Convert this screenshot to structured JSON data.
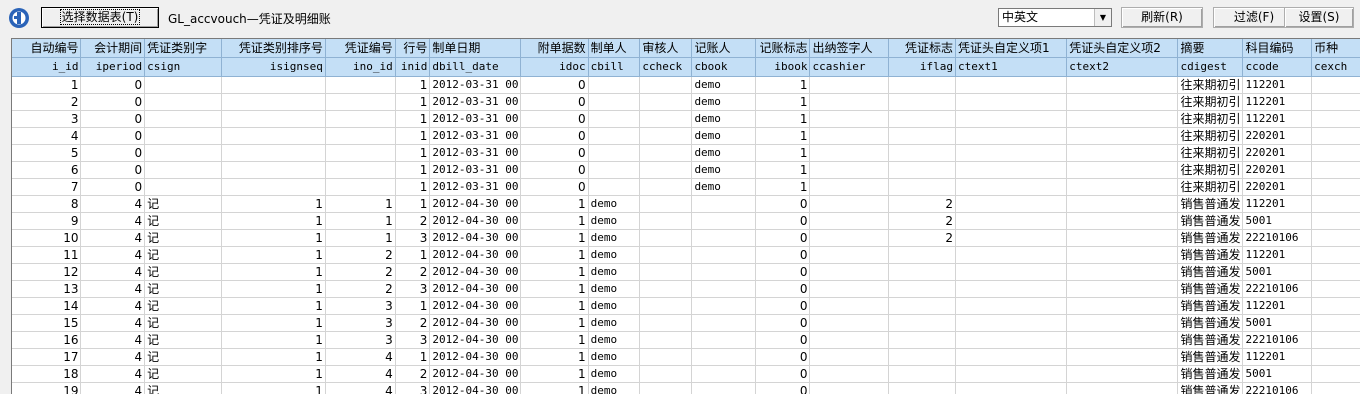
{
  "toolbar": {
    "select_table_label": "选择数据表(T)",
    "title": "GL_accvouch—凭证及明细账",
    "language_value": "中英文",
    "refresh_label": "刷新(R)",
    "filter_label": "过滤(F)",
    "settings_label": "设置(S)"
  },
  "grid": {
    "columns": [
      {
        "cn": "自动编号",
        "en": "i_id",
        "align": "r"
      },
      {
        "cn": "会计期间",
        "en": "iperiod",
        "align": "r"
      },
      {
        "cn": "凭证类别字",
        "en": "csign",
        "align": "l"
      },
      {
        "cn": "凭证类别排序号",
        "en": "isignseq",
        "align": "r"
      },
      {
        "cn": "凭证编号",
        "en": "ino_id",
        "align": "r"
      },
      {
        "cn": "行号",
        "en": "inid",
        "align": "r"
      },
      {
        "cn": "制单日期",
        "en": "dbill_date",
        "align": "l"
      },
      {
        "cn": "附单据数",
        "en": "idoc",
        "align": "r"
      },
      {
        "cn": "制单人",
        "en": "cbill",
        "align": "l"
      },
      {
        "cn": "审核人",
        "en": "ccheck",
        "align": "l"
      },
      {
        "cn": "记账人",
        "en": "cbook",
        "align": "l"
      },
      {
        "cn": "记账标志",
        "en": "ibook",
        "align": "r"
      },
      {
        "cn": "出纳签字人",
        "en": "ccashier",
        "align": "l"
      },
      {
        "cn": "凭证标志",
        "en": "iflag",
        "align": "r"
      },
      {
        "cn": "凭证头自定义项1",
        "en": "ctext1",
        "align": "l"
      },
      {
        "cn": "凭证头自定义项2",
        "en": "ctext2",
        "align": "l"
      },
      {
        "cn": "摘要",
        "en": "cdigest",
        "align": "l"
      },
      {
        "cn": "科目编码",
        "en": "ccode",
        "align": "l"
      },
      {
        "cn": "币种",
        "en": "cexch",
        "align": "l"
      }
    ],
    "rows": [
      [
        "1",
        "0",
        "",
        "",
        "",
        "1",
        "2012-03-31 00",
        "0",
        "",
        "",
        "demo",
        "1",
        "",
        "",
        "",
        "",
        "往来期初引",
        "112201",
        ""
      ],
      [
        "2",
        "0",
        "",
        "",
        "",
        "1",
        "2012-03-31 00",
        "0",
        "",
        "",
        "demo",
        "1",
        "",
        "",
        "",
        "",
        "往来期初引",
        "112201",
        ""
      ],
      [
        "3",
        "0",
        "",
        "",
        "",
        "1",
        "2012-03-31 00",
        "0",
        "",
        "",
        "demo",
        "1",
        "",
        "",
        "",
        "",
        "往来期初引",
        "112201",
        ""
      ],
      [
        "4",
        "0",
        "",
        "",
        "",
        "1",
        "2012-03-31 00",
        "0",
        "",
        "",
        "demo",
        "1",
        "",
        "",
        "",
        "",
        "往来期初引",
        "220201",
        ""
      ],
      [
        "5",
        "0",
        "",
        "",
        "",
        "1",
        "2012-03-31 00",
        "0",
        "",
        "",
        "demo",
        "1",
        "",
        "",
        "",
        "",
        "往来期初引",
        "220201",
        ""
      ],
      [
        "6",
        "0",
        "",
        "",
        "",
        "1",
        "2012-03-31 00",
        "0",
        "",
        "",
        "demo",
        "1",
        "",
        "",
        "",
        "",
        "往来期初引",
        "220201",
        ""
      ],
      [
        "7",
        "0",
        "",
        "",
        "",
        "1",
        "2012-03-31 00",
        "0",
        "",
        "",
        "demo",
        "1",
        "",
        "",
        "",
        "",
        "往来期初引",
        "220201",
        ""
      ],
      [
        "8",
        "4",
        "记",
        "1",
        "1",
        "1",
        "2012-04-30 00",
        "1",
        "demo",
        "",
        "",
        "0",
        "",
        "2",
        "",
        "",
        "销售普通发",
        "112201",
        ""
      ],
      [
        "9",
        "4",
        "记",
        "1",
        "1",
        "2",
        "2012-04-30 00",
        "1",
        "demo",
        "",
        "",
        "0",
        "",
        "2",
        "",
        "",
        "销售普通发",
        "5001",
        ""
      ],
      [
        "10",
        "4",
        "记",
        "1",
        "1",
        "3",
        "2012-04-30 00",
        "1",
        "demo",
        "",
        "",
        "0",
        "",
        "2",
        "",
        "",
        "销售普通发",
        "22210106",
        ""
      ],
      [
        "11",
        "4",
        "记",
        "1",
        "2",
        "1",
        "2012-04-30 00",
        "1",
        "demo",
        "",
        "",
        "0",
        "",
        "",
        "",
        "",
        "销售普通发",
        "112201",
        ""
      ],
      [
        "12",
        "4",
        "记",
        "1",
        "2",
        "2",
        "2012-04-30 00",
        "1",
        "demo",
        "",
        "",
        "0",
        "",
        "",
        "",
        "",
        "销售普通发",
        "5001",
        ""
      ],
      [
        "13",
        "4",
        "记",
        "1",
        "2",
        "3",
        "2012-04-30 00",
        "1",
        "demo",
        "",
        "",
        "0",
        "",
        "",
        "",
        "",
        "销售普通发",
        "22210106",
        ""
      ],
      [
        "14",
        "4",
        "记",
        "1",
        "3",
        "1",
        "2012-04-30 00",
        "1",
        "demo",
        "",
        "",
        "0",
        "",
        "",
        "",
        "",
        "销售普通发",
        "112201",
        ""
      ],
      [
        "15",
        "4",
        "记",
        "1",
        "3",
        "2",
        "2012-04-30 00",
        "1",
        "demo",
        "",
        "",
        "0",
        "",
        "",
        "",
        "",
        "销售普通发",
        "5001",
        ""
      ],
      [
        "16",
        "4",
        "记",
        "1",
        "3",
        "3",
        "2012-04-30 00",
        "1",
        "demo",
        "",
        "",
        "0",
        "",
        "",
        "",
        "",
        "销售普通发",
        "22210106",
        ""
      ],
      [
        "17",
        "4",
        "记",
        "1",
        "4",
        "1",
        "2012-04-30 00",
        "1",
        "demo",
        "",
        "",
        "0",
        "",
        "",
        "",
        "",
        "销售普通发",
        "112201",
        ""
      ],
      [
        "18",
        "4",
        "记",
        "1",
        "4",
        "2",
        "2012-04-30 00",
        "1",
        "demo",
        "",
        "",
        "0",
        "",
        "",
        "",
        "",
        "销售普通发",
        "5001",
        ""
      ],
      [
        "19",
        "4",
        "记",
        "1",
        "4",
        "3",
        "2012-04-30 00",
        "1",
        "demo",
        "",
        "",
        "0",
        "",
        "",
        "",
        "",
        "销售普通发",
        "22210106",
        ""
      ]
    ]
  }
}
